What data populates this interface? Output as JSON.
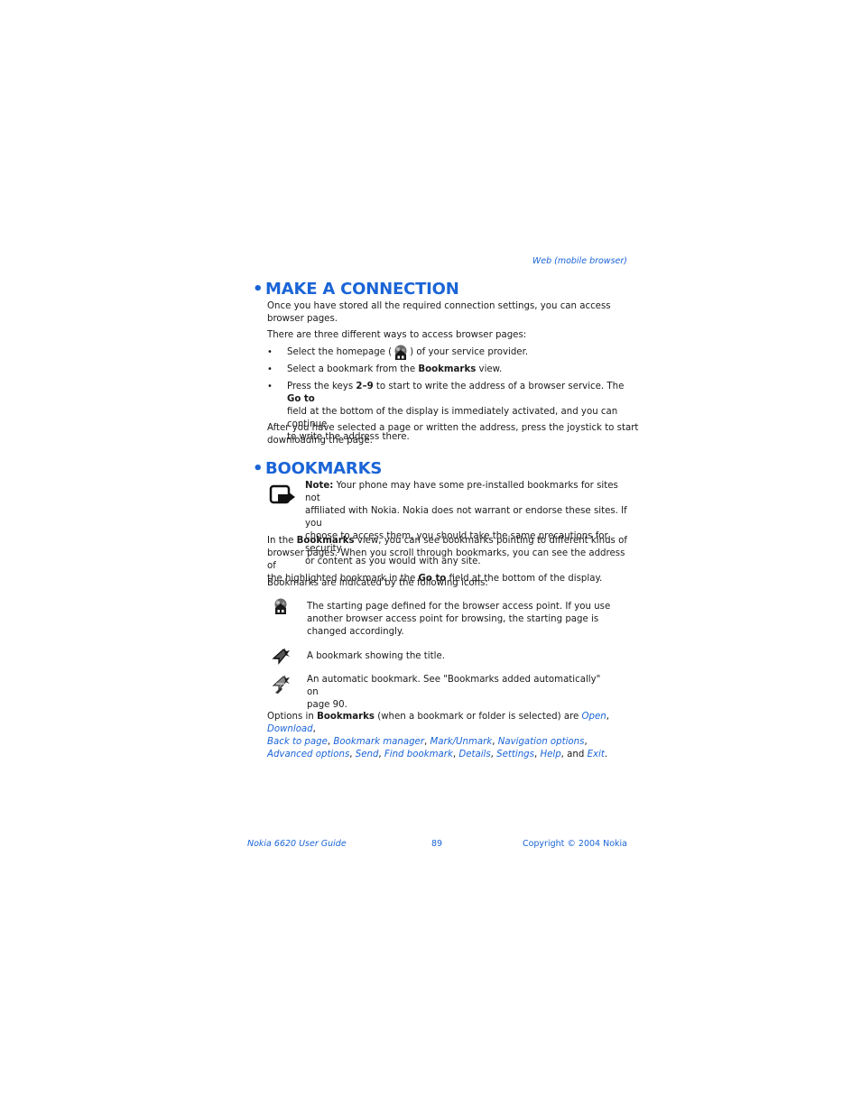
{
  "header": {
    "section": "Web (mobile browser)"
  },
  "make_connection": {
    "title": "MAKE A CONNECTION",
    "bullet_glyph": "•",
    "intro_line1": "Once you have stored all the required connection settings, you can access",
    "intro_line2": "browser pages.",
    "ways_intro": "There are three different ways to access browser pages:",
    "bullets": [
      {
        "pre": "Select the homepage (",
        "icon": "homepage-icon",
        "post": ") of your service provider."
      },
      {
        "pre": "Select a bookmark from the ",
        "bold": "Bookmarks",
        "post": " view."
      },
      {
        "pre": "Press the keys ",
        "bold1": "2–9",
        "mid": " to start to write the address of a browser service. The ",
        "bold2": "Go to",
        "line2": "field at the bottom of the display is immediately activated, and you can continue",
        "line3": "to write the address there."
      }
    ],
    "after_line1": "After you have selected a page or written the address, press the joystick to start",
    "after_line2": "downloading the page."
  },
  "bookmarks": {
    "title": "BOOKMARKS",
    "note": {
      "icon": "note-icon",
      "label": "Note:",
      "line1": " Your phone may have some pre-installed bookmarks for sites not",
      "line2": "affiliated with Nokia. Nokia does not warrant or endorse these sites. If you",
      "line3": "choose to access them, you should take the same precautions for security",
      "line4": "or content as you would with any site."
    },
    "para": {
      "pre": "In the ",
      "bold1": "Bookmarks",
      "line1_post": " view, you can see bookmarks pointing to different kinds of",
      "line2": "browser pages. When you scroll through bookmarks, you can see the address of",
      "line3_pre": "the highlighted bookmark in the ",
      "bold2": "Go to",
      "line3_post": " field at the bottom of the display."
    },
    "icons_intro": "Bookmarks are indicated by the following icons:",
    "icon_items": [
      {
        "icon": "starting-page-icon",
        "lines": [
          "The starting page defined for the browser access point. If you use",
          "another browser access point for browsing, the starting page is",
          "changed accordingly."
        ]
      },
      {
        "icon": "bookmark-title-icon",
        "lines": [
          "A bookmark showing the title."
        ]
      },
      {
        "icon": "automatic-bookmark-icon",
        "lines": [
          "An automatic bookmark. See \"Bookmarks added automatically\" on",
          "page 90."
        ]
      }
    ],
    "options": {
      "pre": "Options in ",
      "bold": "Bookmarks",
      "post": " (when a bookmark or folder is selected) are ",
      "items": [
        "Open",
        "Download",
        "Back to page",
        "Bookmark manager",
        "Mark/Unmark",
        "Navigation options",
        "Advanced options",
        "Send",
        "Find bookmark",
        "Details",
        "Settings",
        "Help",
        "Exit"
      ],
      "and_word": "and"
    }
  },
  "footer": {
    "left": "Nokia 6620 User Guide",
    "page": "89",
    "right": "Copyright © 2004 Nokia"
  },
  "colors": {
    "accent": "#1a64d6",
    "text": "#1a1a1a"
  }
}
